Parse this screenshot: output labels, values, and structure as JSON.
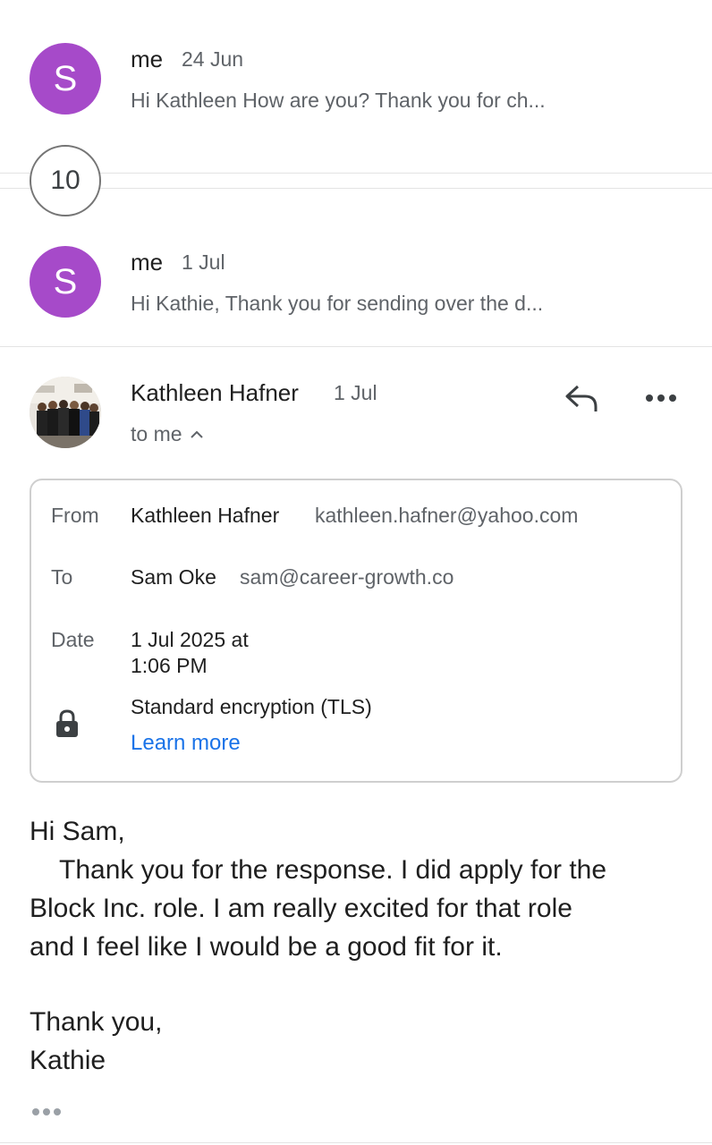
{
  "messages": [
    {
      "avatar_letter": "S",
      "sender": "me",
      "date": "24 Jun",
      "snippet": "Hi Kathleen How are you? Thank you for ch..."
    },
    {
      "avatar_letter": "S",
      "sender": "me",
      "date": "1 Jul",
      "snippet": "Hi Kathie, Thank you for sending over the d..."
    }
  ],
  "collapsed_count": "10",
  "open_message": {
    "sender": "Kathleen Hafner",
    "date": "1 Jul",
    "recipient_summary": "to me",
    "details": {
      "from_label": "From",
      "from_name": "Kathleen Hafner",
      "from_email": "kathleen.hafner@yahoo.com",
      "to_label": "To",
      "to_name": "Sam Oke",
      "to_email": "sam@career-growth.co",
      "date_label": "Date",
      "date_line1": "1 Jul 2025 at",
      "date_line2": "1:06 PM",
      "encryption": "Standard encryption (TLS)",
      "learn_more": "Learn more"
    },
    "body": {
      "greeting": "Hi Sam,",
      "line1": "Thank you for the response. I did apply for the",
      "line2": "Block Inc. role. I am really excited for that role",
      "line3": "and I feel like I would be a good fit for it.",
      "signoff": "Thank you,",
      "signature": "Kathie"
    }
  },
  "colors": {
    "avatar_purple": "#a64ac9",
    "link_blue": "#1a73e8",
    "secondary_text": "#5f6368"
  },
  "icons": {
    "reply": "reply-icon",
    "more": "more-options-icon",
    "chevron": "chevron-up-icon",
    "lock": "lock-icon",
    "trimmed": "show-trimmed-content-icon"
  }
}
